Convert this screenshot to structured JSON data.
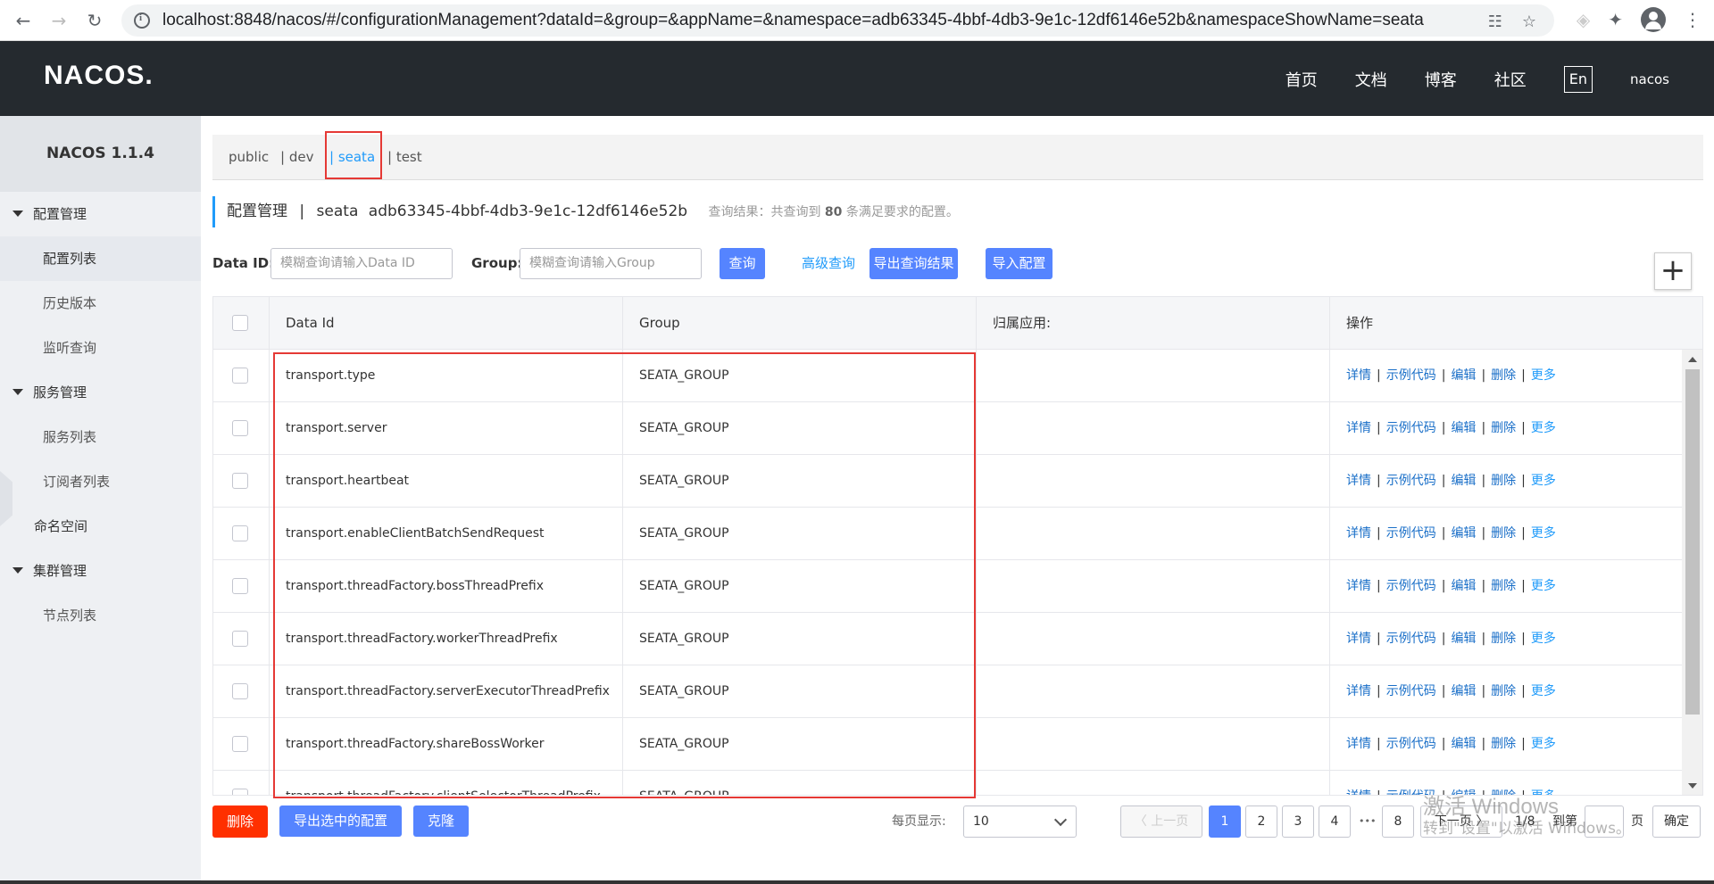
{
  "browser": {
    "url": "localhost:8848/nacos/#/configurationManagement?dataId=&group=&appName=&namespace=adb63345-4bbf-4db3-9e1c-12df6146e52b&namespaceShowName=seata"
  },
  "header": {
    "logo": "NACOS.",
    "nav": [
      "首页",
      "文档",
      "博客",
      "社区"
    ],
    "lang": "En",
    "user": "nacos"
  },
  "sidebar": {
    "title": "NACOS 1.1.4",
    "groups": [
      {
        "label": "配置管理",
        "items": [
          "配置列表",
          "历史版本",
          "监听查询"
        ]
      },
      {
        "label": "服务管理",
        "items": [
          "服务列表",
          "订阅者列表"
        ]
      },
      {
        "label": "命名空间",
        "items": []
      },
      {
        "label": "集群管理",
        "items": [
          "节点列表"
        ]
      }
    ]
  },
  "namespaces": [
    {
      "label": "public",
      "active": false
    },
    {
      "label": "| dev",
      "active": false
    },
    {
      "label": "| seata",
      "active": true
    },
    {
      "label": "| test",
      "active": false
    }
  ],
  "page": {
    "title": "配置管理",
    "sep": "|",
    "ns_name": "seata",
    "ns_id": "adb63345-4bbf-4db3-9e1c-12df6146e52b",
    "hint_prefix": "查询结果：共查询到",
    "hint_count": "80",
    "hint_suffix": "条满足要求的配置。"
  },
  "search": {
    "dataid_label": "Data ID:",
    "dataid_placeholder": "模糊查询请输入Data ID",
    "group_label": "Group:",
    "group_placeholder": "模糊查询请输入Group",
    "query": "查询",
    "advanced": "高级查询",
    "export_results": "导出查询结果",
    "import": "导入配置",
    "plus": "+"
  },
  "table": {
    "headers": [
      "Data Id",
      "Group",
      "归属应用:",
      "操作"
    ],
    "ops": [
      "详情",
      "示例代码",
      "编辑",
      "删除",
      "更多"
    ],
    "rows": [
      {
        "data_id": "transport.type",
        "group": "SEATA_GROUP"
      },
      {
        "data_id": "transport.server",
        "group": "SEATA_GROUP"
      },
      {
        "data_id": "transport.heartbeat",
        "group": "SEATA_GROUP"
      },
      {
        "data_id": "transport.enableClientBatchSendRequest",
        "group": "SEATA_GROUP"
      },
      {
        "data_id": "transport.threadFactory.bossThreadPrefix",
        "group": "SEATA_GROUP"
      },
      {
        "data_id": "transport.threadFactory.workerThreadPrefix",
        "group": "SEATA_GROUP"
      },
      {
        "data_id": "transport.threadFactory.serverExecutorThreadPrefix",
        "group": "SEATA_GROUP"
      },
      {
        "data_id": "transport.threadFactory.shareBossWorker",
        "group": "SEATA_GROUP"
      },
      {
        "data_id": "transport.threadFactory.clientSelectorThreadPrefix",
        "group": "SEATA_GROUP"
      }
    ]
  },
  "footer": {
    "delete": "删除",
    "export_selected": "导出选中的配置",
    "clone": "克隆",
    "per_page_label": "每页显示:",
    "per_page": "10",
    "prev": "〈 上一页",
    "pages": [
      "1",
      "2",
      "3",
      "4"
    ],
    "ellipsis": "•••",
    "last_page": "8",
    "next": "下一页 〉",
    "page_info": "1/8",
    "goto": "到第",
    "page_unit": "页",
    "confirm": "确定",
    "current_page": "1"
  },
  "watermark": {
    "line1": "激活 Windows",
    "line2": "转到\"设置\"以激活 Windows。"
  }
}
